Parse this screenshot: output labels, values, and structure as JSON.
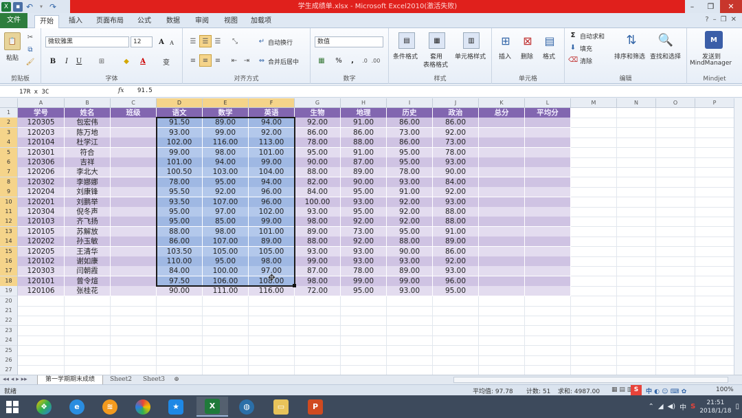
{
  "titlebar": {
    "title": "学生成绩单.xlsx - Microsoft Excel2010(激活失败)"
  },
  "tabs": [
    "文件",
    "开始",
    "插入",
    "页面布局",
    "公式",
    "数据",
    "审阅",
    "视图",
    "加载项"
  ],
  "ribbon": {
    "clipboard": {
      "paste": "粘贴",
      "group": "剪贴板"
    },
    "font": {
      "name": "微软雅黑",
      "size": "12",
      "bold": "B",
      "italic": "I",
      "underline": "U",
      "group": "字体",
      "grow": "A",
      "shrink": "A",
      "font_color_letter": "A",
      "wen": "变"
    },
    "alignment": {
      "wrap": "自动换行",
      "merge": "合并后居中",
      "group": "对齐方式"
    },
    "number": {
      "format": "数值",
      "percent": "%",
      "comma": ",",
      "group": "数字"
    },
    "styles": {
      "cond": "条件格式",
      "table1": "套用",
      "table2": "表格格式",
      "cell": "单元格样式",
      "group": "样式"
    },
    "cells": {
      "insert": "插入",
      "delete": "删除",
      "format": "格式",
      "group": "单元格"
    },
    "editing": {
      "autosum": "自动求和",
      "fill": "填充",
      "clear": "清除",
      "sort": "排序和筛选",
      "find": "查找和选择",
      "group": "编辑"
    },
    "mindjet": {
      "send1": "发送到",
      "send2": "MindManager",
      "group": "Mindjet"
    }
  },
  "formula_bar": {
    "name_box": "17R x 3C",
    "fx": "fx",
    "value": "91.5"
  },
  "columns": [
    "A",
    "B",
    "C",
    "D",
    "E",
    "F",
    "G",
    "H",
    "I",
    "J",
    "K",
    "L",
    "M",
    "N",
    "O",
    "P"
  ],
  "headers": [
    "学号",
    "姓名",
    "班级",
    "语文",
    "数学",
    "英语",
    "生物",
    "地理",
    "历史",
    "政治",
    "总分",
    "平均分"
  ],
  "rows": [
    [
      "120305",
      "包宏伟",
      "",
      "91.50",
      "89.00",
      "94.00",
      "92.00",
      "91.00",
      "86.00",
      "86.00",
      "",
      ""
    ],
    [
      "120203",
      "陈万地",
      "",
      "93.00",
      "99.00",
      "92.00",
      "86.00",
      "86.00",
      "73.00",
      "92.00",
      "",
      ""
    ],
    [
      "120104",
      "杜学江",
      "",
      "102.00",
      "116.00",
      "113.00",
      "78.00",
      "88.00",
      "86.00",
      "73.00",
      "",
      ""
    ],
    [
      "120301",
      "符合",
      "",
      "99.00",
      "98.00",
      "101.00",
      "95.00",
      "91.00",
      "95.00",
      "78.00",
      "",
      ""
    ],
    [
      "120306",
      "吉祥",
      "",
      "101.00",
      "94.00",
      "99.00",
      "90.00",
      "87.00",
      "95.00",
      "93.00",
      "",
      ""
    ],
    [
      "120206",
      "李北大",
      "",
      "100.50",
      "103.00",
      "104.00",
      "88.00",
      "89.00",
      "78.00",
      "90.00",
      "",
      ""
    ],
    [
      "120302",
      "李娜娜",
      "",
      "78.00",
      "95.00",
      "94.00",
      "82.00",
      "90.00",
      "93.00",
      "84.00",
      "",
      ""
    ],
    [
      "120204",
      "刘康锋",
      "",
      "95.50",
      "92.00",
      "96.00",
      "84.00",
      "95.00",
      "91.00",
      "92.00",
      "",
      ""
    ],
    [
      "120201",
      "刘鹏举",
      "",
      "93.50",
      "107.00",
      "96.00",
      "100.00",
      "93.00",
      "92.00",
      "93.00",
      "",
      ""
    ],
    [
      "120304",
      "倪冬声",
      "",
      "95.00",
      "97.00",
      "102.00",
      "93.00",
      "95.00",
      "92.00",
      "88.00",
      "",
      ""
    ],
    [
      "120103",
      "齐飞扬",
      "",
      "95.00",
      "85.00",
      "99.00",
      "98.00",
      "92.00",
      "92.00",
      "88.00",
      "",
      ""
    ],
    [
      "120105",
      "苏解放",
      "",
      "88.00",
      "98.00",
      "101.00",
      "89.00",
      "73.00",
      "95.00",
      "91.00",
      "",
      ""
    ],
    [
      "120202",
      "孙玉敏",
      "",
      "86.00",
      "107.00",
      "89.00",
      "88.00",
      "92.00",
      "88.00",
      "89.00",
      "",
      ""
    ],
    [
      "120205",
      "王清华",
      "",
      "103.50",
      "105.00",
      "105.00",
      "93.00",
      "93.00",
      "90.00",
      "86.00",
      "",
      ""
    ],
    [
      "120102",
      "谢如康",
      "",
      "110.00",
      "95.00",
      "98.00",
      "99.00",
      "93.00",
      "93.00",
      "92.00",
      "",
      ""
    ],
    [
      "120303",
      "闫朝霞",
      "",
      "84.00",
      "100.00",
      "97.00",
      "87.00",
      "78.00",
      "89.00",
      "93.00",
      "",
      ""
    ],
    [
      "120101",
      "曾令煊",
      "",
      "97.50",
      "106.00",
      "108.00",
      "98.00",
      "99.00",
      "99.00",
      "96.00",
      "",
      ""
    ],
    [
      "120106",
      "张桂花",
      "",
      "90.00",
      "111.00",
      "116.00",
      "72.00",
      "95.00",
      "93.00",
      "95.00",
      "",
      ""
    ]
  ],
  "row_numbers": [
    "1",
    "2",
    "3",
    "4",
    "5",
    "6",
    "7",
    "8",
    "9",
    "10",
    "11",
    "12",
    "13",
    "14",
    "15",
    "16",
    "17",
    "18",
    "19",
    "20",
    "21",
    "22",
    "23",
    "24",
    "25",
    "26",
    "27"
  ],
  "sheets": [
    "第一学期期末成绩",
    "Sheet2",
    "Sheet3"
  ],
  "status": {
    "ready": "就绪",
    "average": "平均值: 97.78",
    "count": "计数: 51",
    "sum": "求和: 4987.00",
    "zoom": "100%"
  },
  "taskbar": {
    "time": "21:51",
    "date": "2018/1/18",
    "ime": "中",
    "ime2": "中",
    "sogou": "S"
  }
}
